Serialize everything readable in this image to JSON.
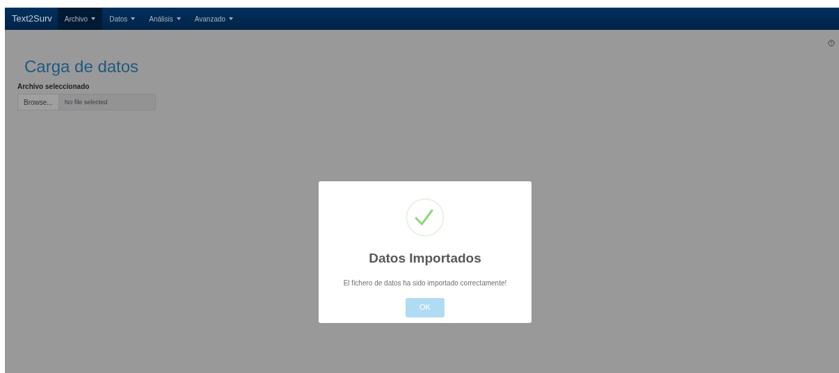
{
  "navbar": {
    "brand": "Text2Surv",
    "menus": [
      {
        "label": "Archivo",
        "selected": true
      },
      {
        "label": "Datos",
        "selected": false
      },
      {
        "label": "Análisis",
        "selected": false
      },
      {
        "label": "Avanzado",
        "selected": false
      }
    ]
  },
  "page": {
    "title": "Carga de datos",
    "file_label": "Archivo seleccionado",
    "browse_button": "Browse...",
    "file_field": {
      "placeholder": "No file selected"
    }
  },
  "dialog": {
    "title": "Datos Importados",
    "message": "El fichero de datos ha sido importado correctamente!",
    "ok_button": "OK"
  }
}
